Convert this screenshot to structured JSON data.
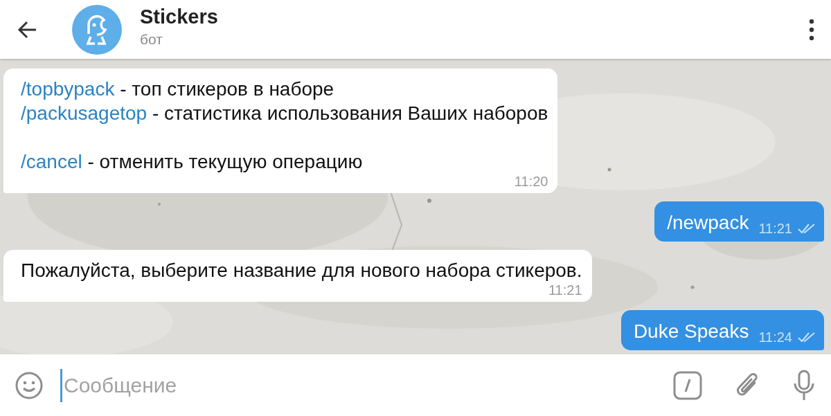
{
  "header": {
    "title": "Stickers",
    "subtitle": "бот"
  },
  "messages": [
    {
      "kind": "incoming",
      "paragraphs": [
        [
          {
            "command": "/topbypack",
            "text": " - топ стикеров в наборе"
          },
          {
            "command": "/packusagetop",
            "text": " - статистика использования Ваших наборов"
          }
        ],
        [
          {
            "command": "/cancel",
            "text": " - отменить текущую операцию"
          }
        ]
      ],
      "time": "11:20"
    },
    {
      "kind": "outgoing",
      "text": "/newpack",
      "time": "11:21",
      "read": true
    },
    {
      "kind": "incoming",
      "paragraphs": [
        [
          {
            "text": "Пожалуйста, выберите название для нового набора стикеров."
          }
        ]
      ],
      "time": "11:21"
    },
    {
      "kind": "outgoing",
      "text": "Duke Speaks",
      "time": "11:24",
      "read": true
    }
  ],
  "composer": {
    "placeholder": "Сообщение"
  }
}
